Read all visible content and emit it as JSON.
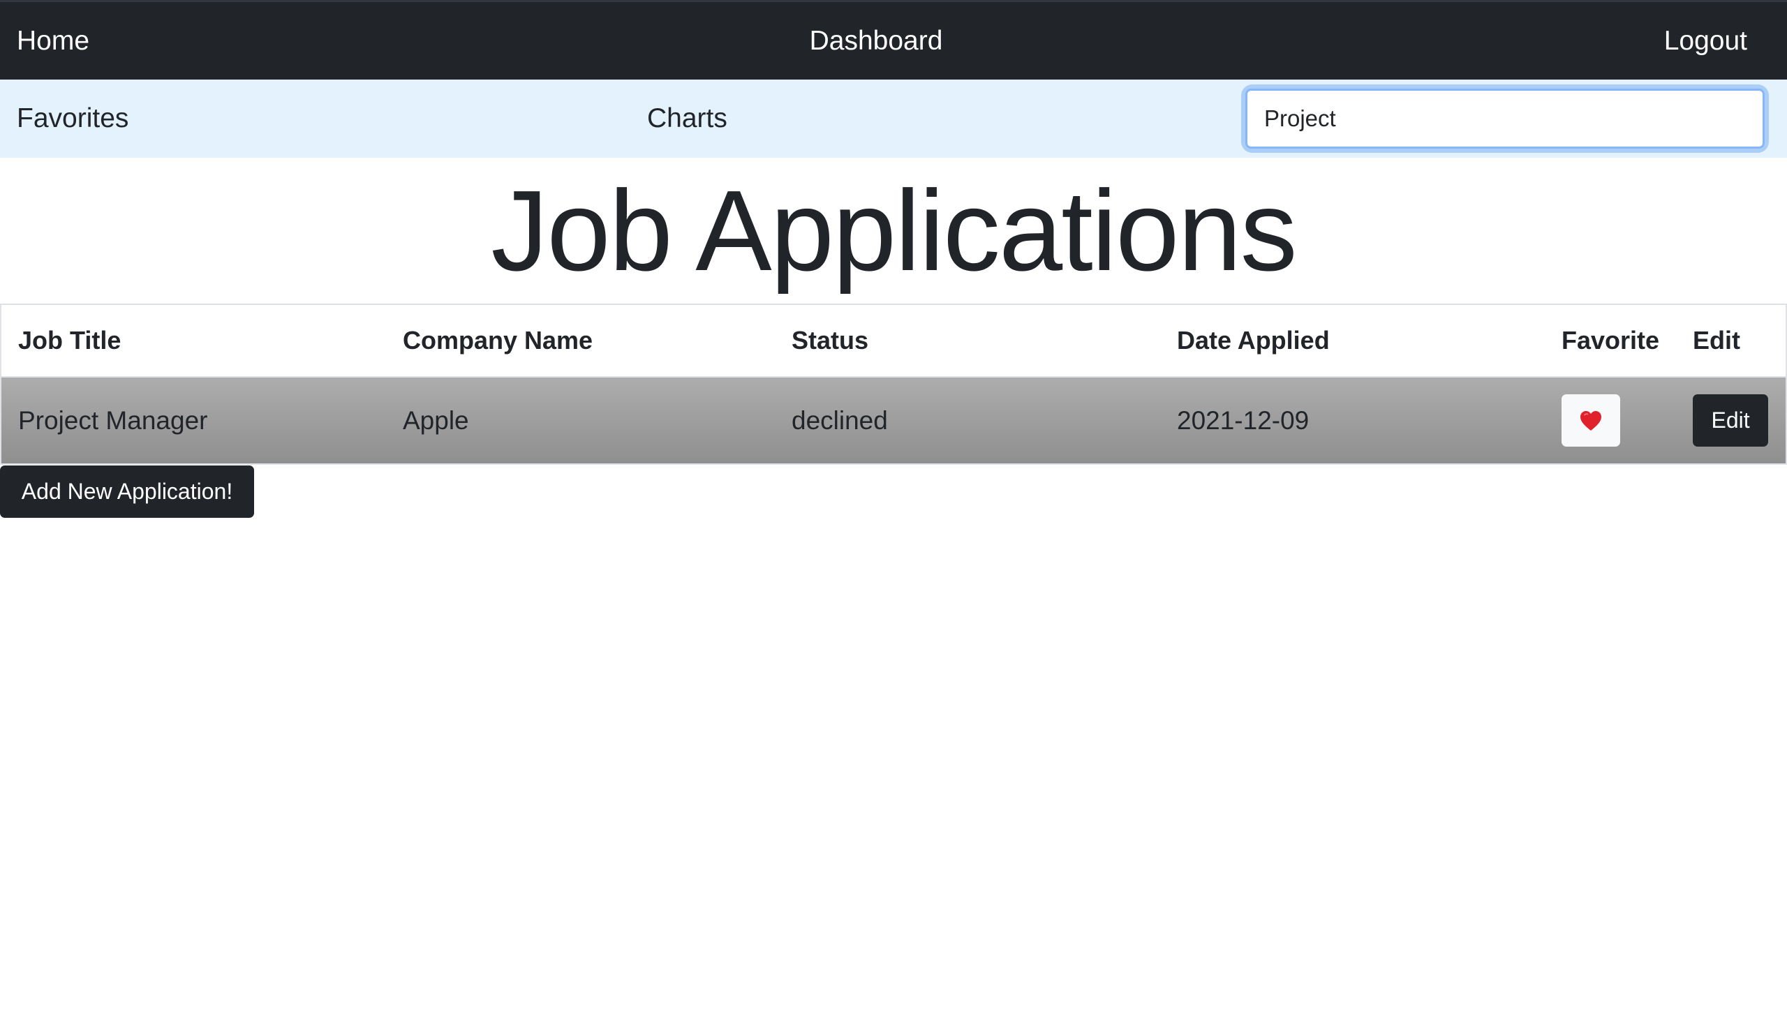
{
  "topnav": {
    "home": "Home",
    "dashboard": "Dashboard",
    "logout": "Logout"
  },
  "subnav": {
    "favorites": "Favorites",
    "charts": "Charts",
    "search": {
      "value": "Project",
      "placeholder": ""
    }
  },
  "page": {
    "title": "Job Applications"
  },
  "table": {
    "headers": {
      "job_title": "Job Title",
      "company_name": "Company Name",
      "status": "Status",
      "date_applied": "Date Applied",
      "favorite": "Favorite",
      "edit": "Edit"
    },
    "rows": [
      {
        "job_title": "Project Manager",
        "company_name": "Apple",
        "status": "declined",
        "date_applied": "2021-12-09",
        "favorite_icon": "heart-icon",
        "favorite_color": "#e0202b",
        "edit_label": "Edit"
      }
    ]
  },
  "actions": {
    "add_label": "Add New Application!"
  },
  "colors": {
    "navbar_dark": "#212529",
    "navbar_light": "#e3f2fd",
    "row_gradient_top": "#adadad",
    "row_gradient_bottom": "#8f8f8f",
    "focus_ring": "#86b7fe"
  }
}
